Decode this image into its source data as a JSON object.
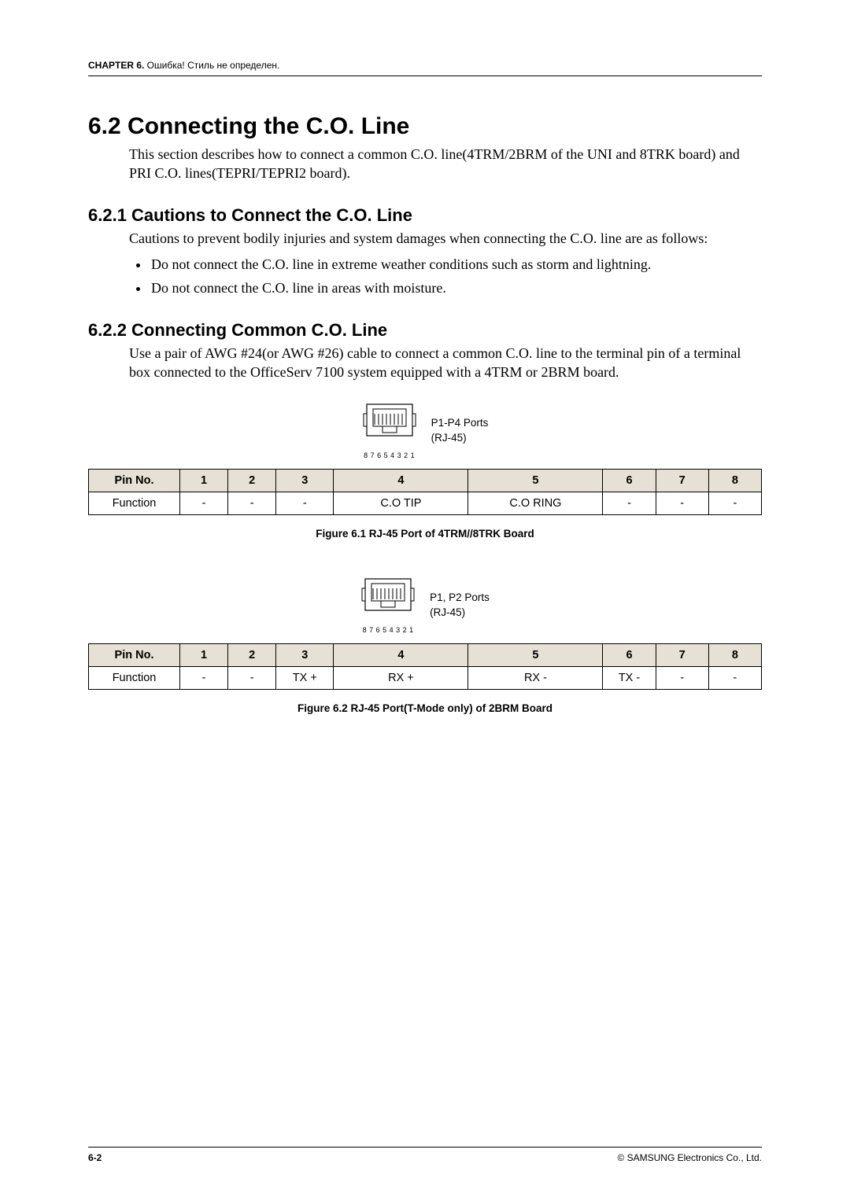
{
  "header": {
    "chapter_label": "CHAPTER 6.",
    "chapter_note": " Ошибка! Стиль не определен."
  },
  "footer": {
    "page_num": "6-2",
    "copyright": "© SAMSUNG Electronics Co., Ltd."
  },
  "section": {
    "title": "6.2  Connecting the C.O. Line",
    "intro": "This section describes how to connect a common C.O. line(4TRM/2BRM of the UNI and 8TRK board) and PRI C.O. lines(TEPRI/TEPRI2 board)."
  },
  "sub1": {
    "title": "6.2.1  Cautions to Connect the C.O. Line",
    "intro": "Cautions to prevent bodily injuries and system damages when connecting the C.O. line are as follows:",
    "b1": "Do not connect the C.O. line in extreme weather conditions such as storm and lightning.",
    "b2": "Do not connect the C.O. line in areas with moisture."
  },
  "sub2": {
    "title": "6.2.2  Connecting Common C.O. Line",
    "intro": "Use a pair of AWG #24(or AWG #26) cable to connect a common C.O. line to the terminal pin of a terminal box connected to the OfficeServ 7100 system equipped with a 4TRM or 2BRM board."
  },
  "fig1": {
    "port_label_l1": "P1-P4 Ports",
    "port_label_l2": "(RJ-45)",
    "pin_digits": "8 7 6 5 4 3 2 1",
    "caption": "Figure 6.1   RJ-45 Port of 4TRM//8TRK Board"
  },
  "fig2": {
    "port_label_l1": "P1, P2 Ports",
    "port_label_l2": "(RJ-45)",
    "pin_digits": "8 7 6 5 4 3 2 1",
    "caption": "Figure 6.2   RJ-45 Port(T-Mode only) of 2BRM Board"
  },
  "table_header": {
    "pin_no": "Pin No.",
    "c1": "1",
    "c2": "2",
    "c3": "3",
    "c4": "4",
    "c5": "5",
    "c6": "6",
    "c7": "7",
    "c8": "8"
  },
  "table1": {
    "row_h": "Function",
    "c1": "-",
    "c2": "-",
    "c3": "-",
    "c4": "C.O TIP",
    "c5": "C.O RING",
    "c6": "-",
    "c7": "-",
    "c8": "-"
  },
  "table2": {
    "row_h": "Function",
    "c1": "-",
    "c2": "-",
    "c3": "TX +",
    "c4": "RX +",
    "c5": "RX -",
    "c6": "TX -",
    "c7": "-",
    "c8": "-"
  }
}
